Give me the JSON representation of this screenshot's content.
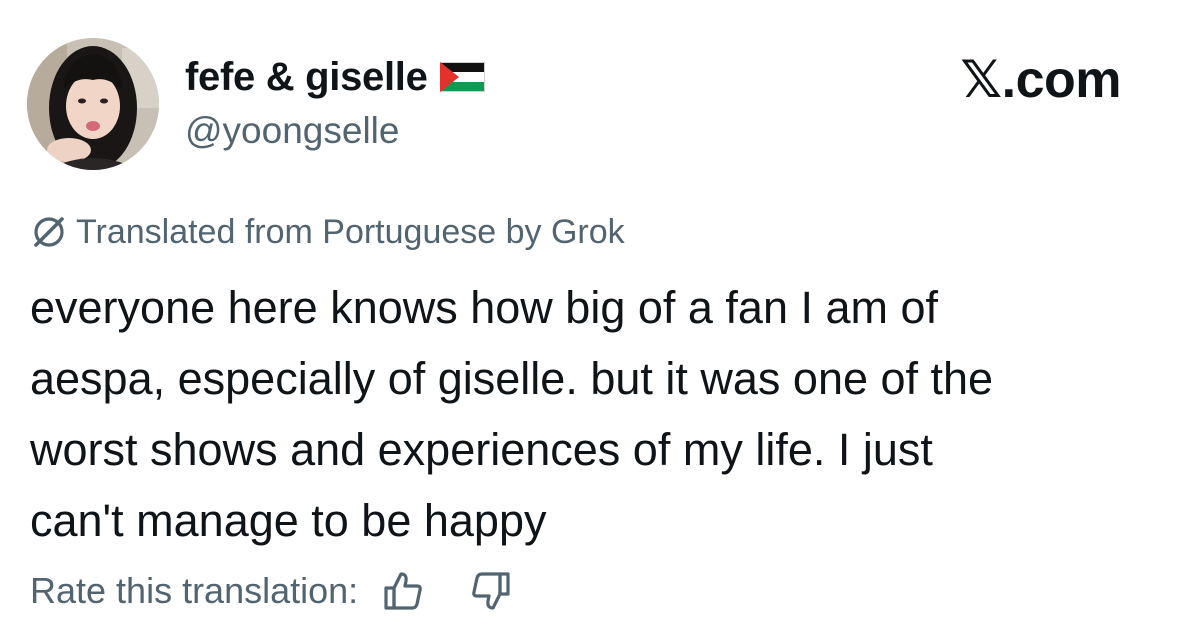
{
  "author": {
    "display_name": "fefe & giselle",
    "handle": "@yoongselle",
    "avatar_icon": "profile-photo",
    "flag_icon": "palestine-flag-icon"
  },
  "brand": "𝕏.com",
  "translation": {
    "label": "Translated from Portuguese by Grok",
    "icon": "grok-icon"
  },
  "tweet": {
    "text": "everyone here knows how big of a fan I am of\naespa, especially of giselle. but it was one of the\nworst shows and experiences of my life. I just\ncan't manage to be happy"
  },
  "rating": {
    "label": "Rate this translation:",
    "up_icon": "thumbs-up-icon",
    "down_icon": "thumbs-down-icon"
  },
  "colors": {
    "text_primary": "#0f1419",
    "text_secondary": "#536471",
    "background": "#ffffff"
  }
}
